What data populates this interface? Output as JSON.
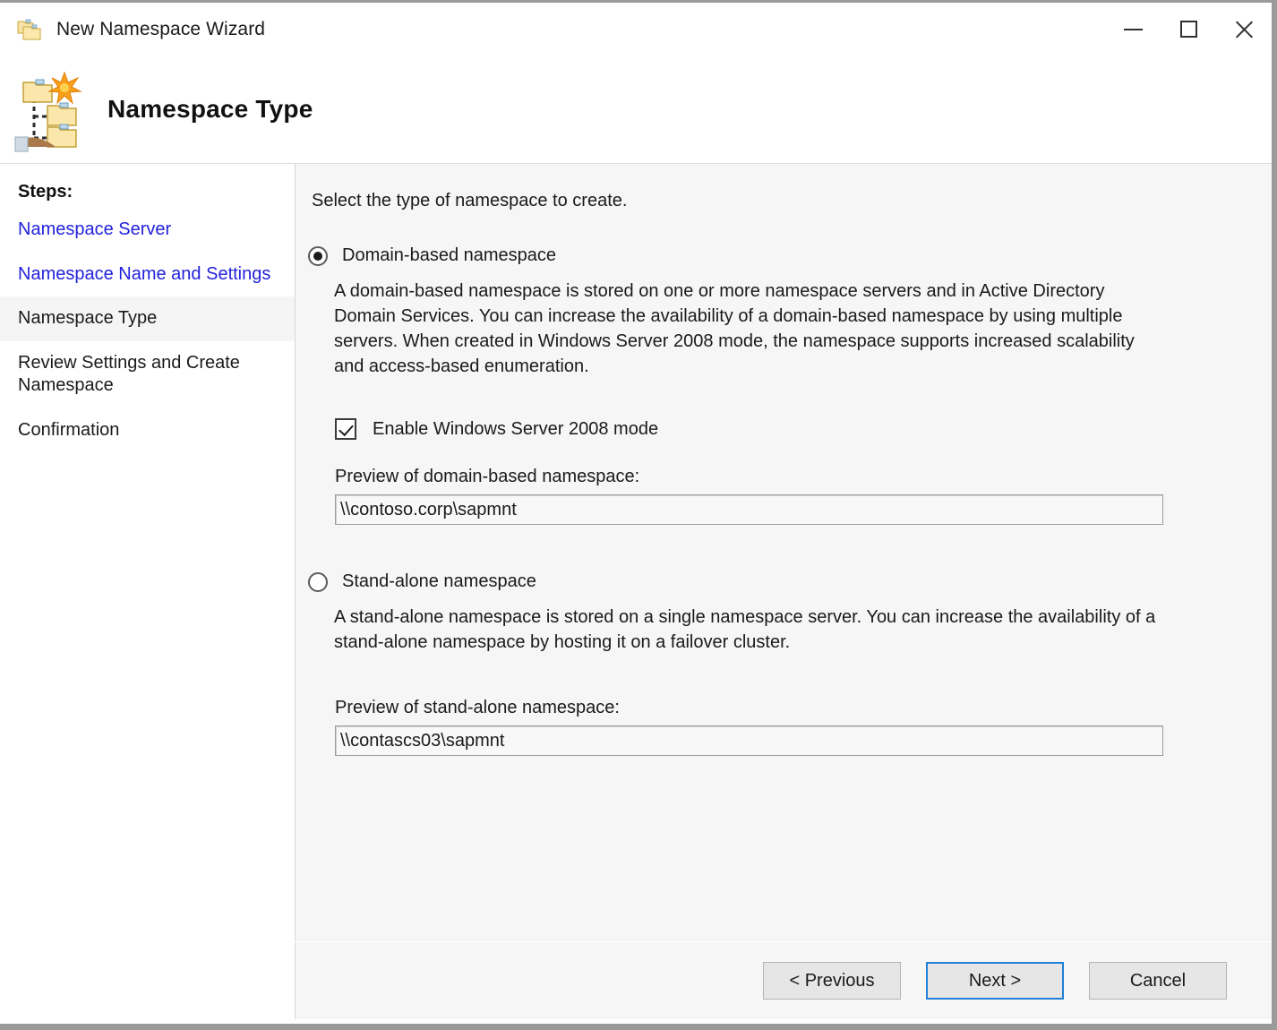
{
  "window": {
    "title": "New Namespace Wizard",
    "title_icon": "namespace-folders-icon",
    "minimize_label": "Minimize",
    "maximize_label": "Maximize",
    "close_label": "Close"
  },
  "header": {
    "title": "Namespace Type",
    "icon": "dfs-namespace-wizard-icon"
  },
  "sidebar": {
    "heading": "Steps:",
    "items": [
      {
        "label": "Namespace Server",
        "state": "completed"
      },
      {
        "label": "Namespace Name and Settings",
        "state": "completed"
      },
      {
        "label": "Namespace Type",
        "state": "current"
      },
      {
        "label": "Review Settings and Create Namespace",
        "state": "pending"
      },
      {
        "label": "Confirmation",
        "state": "pending"
      }
    ]
  },
  "main": {
    "intro": "Select the type of namespace to create.",
    "options": [
      {
        "id": "domain-based",
        "label": "Domain-based namespace",
        "selected": true,
        "description": "A domain-based namespace is stored on one or more namespace servers and in Active Directory Domain Services. You can increase the availability of a domain-based namespace by using multiple servers. When created in Windows Server 2008 mode, the namespace supports increased scalability and access-based enumeration.",
        "checkbox": {
          "label": "Enable Windows Server 2008 mode",
          "checked": true
        },
        "preview_label": "Preview of domain-based namespace:",
        "preview_value": "\\\\contoso.corp\\sapmnt"
      },
      {
        "id": "stand-alone",
        "label": "Stand-alone namespace",
        "selected": false,
        "description": "A stand-alone namespace is stored on a single namespace server. You can increase the availability of a stand-alone namespace by hosting it on a failover cluster.",
        "preview_label": "Preview of stand-alone namespace:",
        "preview_value": "\\\\contascs03\\sapmnt"
      }
    ]
  },
  "footer": {
    "previous": "< Previous",
    "next": "Next >",
    "cancel": "Cancel"
  },
  "colors": {
    "link": "#2222dd",
    "focus_border": "#1f7fd6",
    "content_bg": "#f6f6f6",
    "sidebar_bg": "#ffffff",
    "current_step_bg": "#f5f5f5"
  }
}
